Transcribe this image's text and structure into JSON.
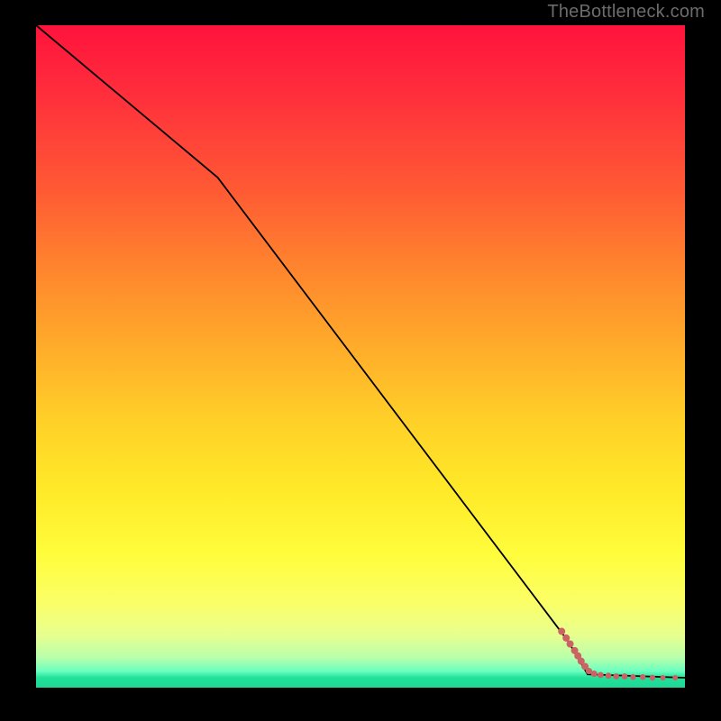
{
  "watermark": "TheBottleneck.com",
  "colors": {
    "marker": "#cb6364",
    "curve": "#000000",
    "background": "#000000"
  },
  "chart_data": {
    "type": "line",
    "title": "",
    "xlabel": "",
    "ylabel": "",
    "xlim": [
      0,
      100
    ],
    "ylim": [
      0,
      100
    ],
    "grid": false,
    "legend": false,
    "series": [
      {
        "name": "bottleneck-curve",
        "x": [
          0,
          28,
          82,
          85,
          100
        ],
        "values": [
          100,
          77,
          7,
          2,
          1.5
        ]
      }
    ],
    "markers": [
      {
        "x": 81.0,
        "y": 8.5,
        "r": 4.0
      },
      {
        "x": 81.7,
        "y": 7.5,
        "r": 4.0
      },
      {
        "x": 82.3,
        "y": 6.6,
        "r": 4.0
      },
      {
        "x": 83.0,
        "y": 5.6,
        "r": 4.0
      },
      {
        "x": 83.5,
        "y": 4.8,
        "r": 4.0
      },
      {
        "x": 84.0,
        "y": 4.0,
        "r": 4.0
      },
      {
        "x": 84.6,
        "y": 3.2,
        "r": 4.0
      },
      {
        "x": 85.2,
        "y": 2.5,
        "r": 3.6
      },
      {
        "x": 86.0,
        "y": 2.1,
        "r": 3.6
      },
      {
        "x": 87.0,
        "y": 1.9,
        "r": 3.4
      },
      {
        "x": 88.2,
        "y": 1.8,
        "r": 3.4
      },
      {
        "x": 89.4,
        "y": 1.7,
        "r": 3.4
      },
      {
        "x": 90.7,
        "y": 1.7,
        "r": 3.4
      },
      {
        "x": 92.0,
        "y": 1.6,
        "r": 3.2
      },
      {
        "x": 93.5,
        "y": 1.6,
        "r": 3.2
      },
      {
        "x": 95.0,
        "y": 1.5,
        "r": 3.2
      },
      {
        "x": 96.6,
        "y": 1.5,
        "r": 3.0
      },
      {
        "x": 98.5,
        "y": 1.5,
        "r": 3.0
      }
    ]
  }
}
